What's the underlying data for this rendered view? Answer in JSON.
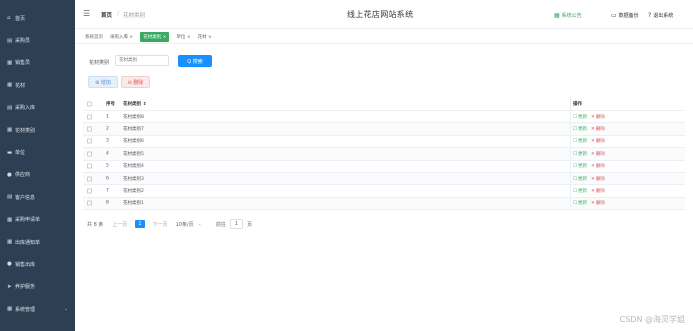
{
  "sidebar": {
    "items": [
      {
        "icon": "home-icon",
        "glyph": "⌂",
        "label": "首页"
      },
      {
        "icon": "list-icon",
        "glyph": "▤",
        "label": "采购员"
      },
      {
        "icon": "grid-icon",
        "glyph": "▦",
        "label": "销售员"
      },
      {
        "icon": "grid-icon",
        "glyph": "▦",
        "label": "花材"
      },
      {
        "icon": "list-icon",
        "glyph": "▤",
        "label": "采购入库"
      },
      {
        "icon": "grid-icon",
        "glyph": "▦",
        "label": "花材类别"
      },
      {
        "icon": "folder-icon",
        "glyph": "▬",
        "label": "单位"
      },
      {
        "icon": "chat-icon",
        "glyph": "●",
        "label": "供应商"
      },
      {
        "icon": "list-icon",
        "glyph": "▤",
        "label": "客户信息"
      },
      {
        "icon": "grid-icon",
        "glyph": "▦",
        "label": "采购申请单"
      },
      {
        "icon": "grid-icon",
        "glyph": "▦",
        "label": "出库通知单"
      },
      {
        "icon": "pin-icon",
        "glyph": "●",
        "label": "销售出库"
      },
      {
        "icon": "send-icon",
        "glyph": "➤",
        "label": "养护服务"
      },
      {
        "icon": "grid-icon",
        "glyph": "▦",
        "label": "系统管理",
        "chevron": "⌄"
      }
    ]
  },
  "header": {
    "menu_glyph": "☰",
    "breadcrumb_home": "首页",
    "breadcrumb_sep": "/",
    "breadcrumb_current": "花材类别",
    "title": "线上花店网站系统",
    "notice": {
      "glyph": "▦",
      "label": "系统公告"
    },
    "backup": {
      "glyph": "▭",
      "label": "数据备份"
    },
    "logout": {
      "glyph": "?",
      "label": "退出系统"
    }
  },
  "tabs": [
    {
      "label": "系统首页",
      "closable": false,
      "active": false
    },
    {
      "label": "采购入库 ×",
      "active": false
    },
    {
      "label": "花材类别 ×",
      "active": true
    },
    {
      "label": "单位 ×",
      "active": false
    },
    {
      "label": "花材 ×",
      "active": false
    }
  ],
  "search": {
    "label": "花材类别",
    "placeholder": "花材类别",
    "button": "Q 搜索"
  },
  "actions": {
    "add": "⊕ 增加",
    "delete": "⊖ 删除"
  },
  "table": {
    "headers": {
      "index": "序号",
      "name": "花材类别 ⇕",
      "op": "操作"
    },
    "rows": [
      {
        "index": "1",
        "name": "花材类别8"
      },
      {
        "index": "2",
        "name": "花材类别7"
      },
      {
        "index": "3",
        "name": "花材类别6"
      },
      {
        "index": "4",
        "name": "花材类别5"
      },
      {
        "index": "5",
        "name": "花材类别4"
      },
      {
        "index": "6",
        "name": "花材类别3"
      },
      {
        "index": "7",
        "name": "花材类别2"
      },
      {
        "index": "8",
        "name": "花材类别1"
      }
    ],
    "edit_label": "更新",
    "delete_label": "删除",
    "edit_glyph": "☐",
    "delete_glyph": "✕"
  },
  "pager": {
    "total": "共 8 条",
    "prev": "上一页",
    "page": "1",
    "next": "下一页",
    "size": "10条/页",
    "caret": "⌄",
    "goto": "前往",
    "goto_value": "1",
    "page_unit": "页"
  },
  "watermark": "CSDN @海灵学姐",
  "colors": {
    "sidebar": "#2f3f53",
    "accent": "#3aaa62",
    "primary": "#1890ff",
    "danger": "#dd5555"
  }
}
